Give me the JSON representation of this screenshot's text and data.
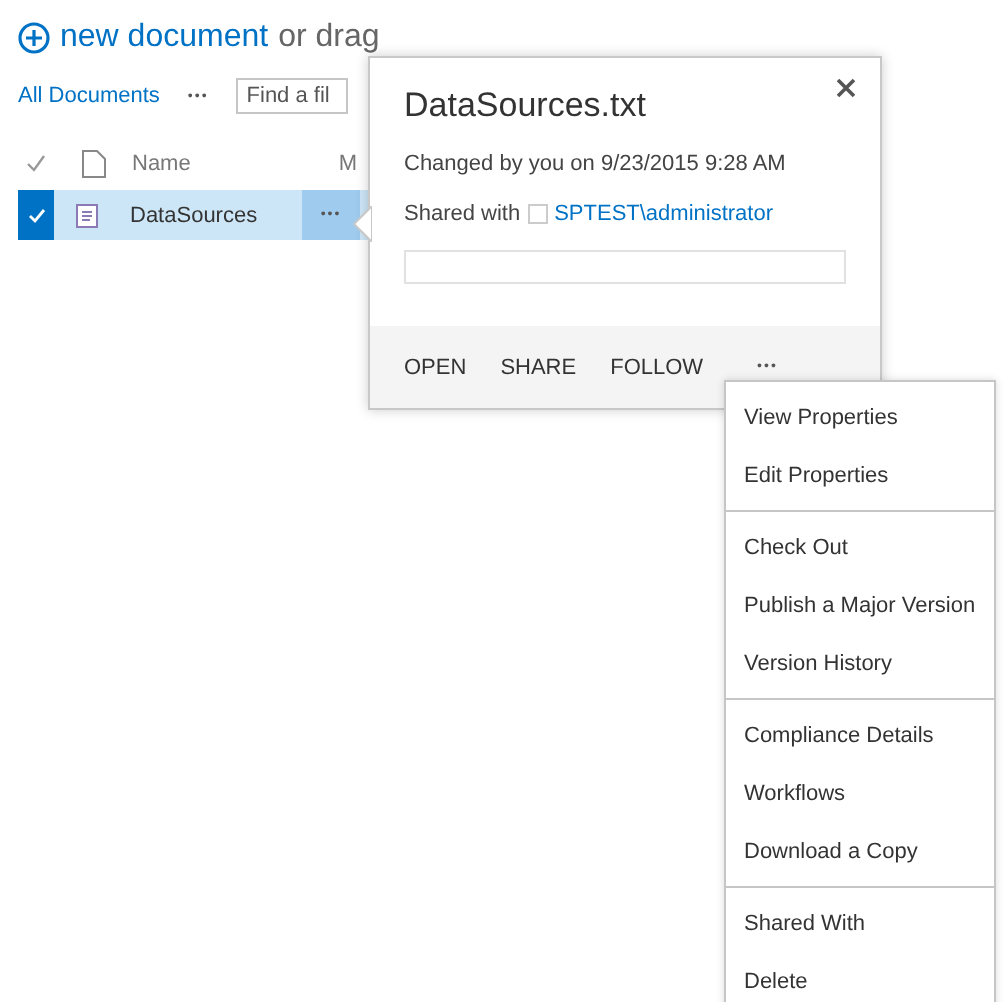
{
  "header": {
    "new_link": "new document",
    "drag_hint": "or drag"
  },
  "views": {
    "current": "All Documents",
    "more": "•••"
  },
  "search": {
    "placeholder": "Find a fil"
  },
  "columns": {
    "name": "Name",
    "column_2": "M"
  },
  "rows": [
    {
      "name": "DataSources",
      "selected": true,
      "more": "•••"
    }
  ],
  "callout": {
    "title": "DataSources.txt",
    "changed": "Changed by you on 9/23/2015 9:28 AM",
    "shared_label": "Shared with",
    "shared_user": "SPTEST\\administrator",
    "actions": [
      "OPEN",
      "SHARE",
      "FOLLOW"
    ],
    "more": "•••"
  },
  "menu": {
    "groups": [
      [
        "View Properties",
        "Edit Properties"
      ],
      [
        "Check Out",
        "Publish a Major Version",
        "Version History"
      ],
      [
        "Compliance Details",
        "Workflows",
        "Download a Copy"
      ],
      [
        "Shared With",
        "Delete"
      ]
    ]
  }
}
